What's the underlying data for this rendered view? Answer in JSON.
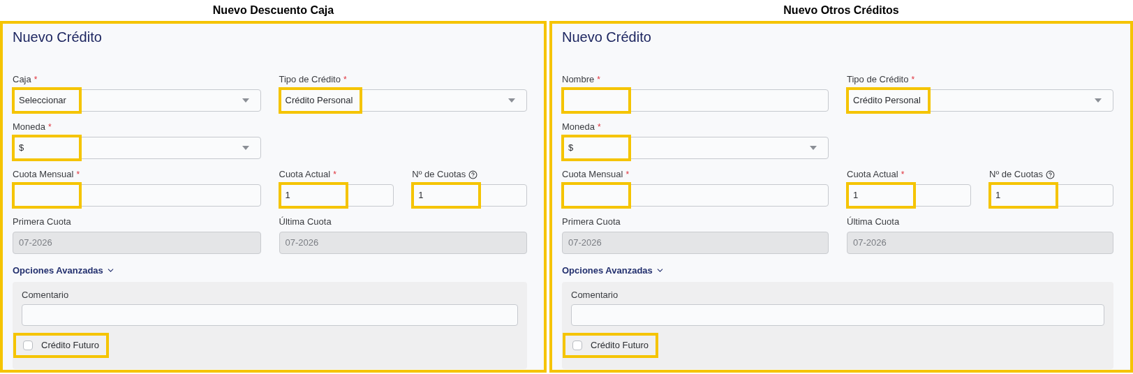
{
  "panels": [
    {
      "caption": "Nuevo Descuento Caja",
      "title": "Nuevo Crédito",
      "rows": [
        [
          {
            "kind": "select",
            "label": "Caja",
            "required_mark": "*",
            "disabled": false,
            "value": "Seleccionar",
            "highlighted": true
          },
          {
            "kind": "select",
            "label": "Tipo de Crédito",
            "required_mark": "*",
            "disabled": false,
            "value": "Crédito Personal",
            "highlighted": true
          }
        ],
        [
          {
            "kind": "select",
            "label": "Moneda",
            "required_mark": "*",
            "disabled": false,
            "value": "$",
            "highlighted": true
          }
        ],
        [
          {
            "kind": "text",
            "label": "Cuota Mensual",
            "required_mark": "*",
            "disabled": false,
            "highlighted": true
          },
          {
            "kind": "text",
            "label": "Cuota Actual",
            "required_mark": "*",
            "disabled": false,
            "value": "1",
            "highlighted": true
          },
          {
            "kind": "text",
            "label": "Nº de Cuotas",
            "help": true,
            "disabled": false,
            "value": "1",
            "highlighted": true
          }
        ],
        [
          {
            "kind": "text",
            "label": "Primera Cuota",
            "disabled": true,
            "value": "07-2026"
          },
          {
            "kind": "text",
            "label": "Última Cuota",
            "disabled": true,
            "value": "07-2026"
          }
        ]
      ],
      "advanced": {
        "label": "Opciones Avanzadas",
        "expanded": true,
        "comment_label": "Comentario",
        "checkbox": {
          "label": "Crédito Futuro",
          "checked": false,
          "highlighted": true
        }
      }
    },
    {
      "caption": "Nuevo Otros Créditos",
      "title": "Nuevo Crédito",
      "rows": [
        [
          {
            "kind": "text",
            "label": "Nombre",
            "required_mark": "*",
            "disabled": false,
            "highlighted": true
          },
          {
            "kind": "select",
            "label": "Tipo de Crédito",
            "required_mark": "*",
            "disabled": false,
            "value": "Crédito Personal",
            "highlighted": true
          }
        ],
        [
          {
            "kind": "select",
            "label": "Moneda",
            "required_mark": "*",
            "disabled": false,
            "value": "$",
            "highlighted": true
          }
        ],
        [
          {
            "kind": "text",
            "label": "Cuota Mensual",
            "required_mark": "*",
            "disabled": false,
            "highlighted": true
          },
          {
            "kind": "text",
            "label": "Cuota Actual",
            "required_mark": "*",
            "disabled": false,
            "value": "1",
            "highlighted": true
          },
          {
            "kind": "text",
            "label": "Nº de Cuotas",
            "help": true,
            "disabled": false,
            "value": "1",
            "highlighted": true
          }
        ],
        [
          {
            "kind": "text",
            "label": "Primera Cuota",
            "disabled": true,
            "value": "07-2026"
          },
          {
            "kind": "text",
            "label": "Última Cuota",
            "disabled": true,
            "value": "07-2026"
          }
        ]
      ],
      "advanced": {
        "label": "Opciones Avanzadas",
        "expanded": true,
        "comment_label": "Comentario",
        "checkbox": {
          "label": "Crédito Futuro",
          "checked": false,
          "highlighted": true
        }
      }
    }
  ]
}
